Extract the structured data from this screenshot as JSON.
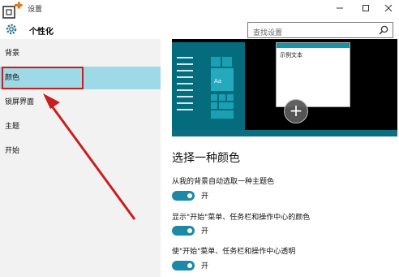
{
  "window": {
    "title": "设置"
  },
  "header": {
    "page_title": "个性化",
    "search_placeholder": "查找设置"
  },
  "sidebar": {
    "items": [
      {
        "label": "背景",
        "active": false
      },
      {
        "label": "颜色",
        "active": true
      },
      {
        "label": "锁屏界面",
        "active": false
      },
      {
        "label": "主题",
        "active": false
      },
      {
        "label": "开始",
        "active": false
      }
    ]
  },
  "preview": {
    "window_text": "示例文本",
    "tile_text": "Aa",
    "add_symbol": "+"
  },
  "main": {
    "section_title": "选择一种颜色",
    "settings": [
      {
        "label": "从我的背景自动选取一种主题色",
        "state": "开",
        "on": true
      },
      {
        "label": "显示\"开始\"菜单、任务栏和操作中心的颜色",
        "state": "开",
        "on": true
      },
      {
        "label": "使\"开始\"菜单、任务栏和操作中心透明",
        "state": "开",
        "on": true
      }
    ]
  },
  "colors": {
    "accent": "#1c8aa6",
    "selected_nav": "#9ed9e8",
    "annotation": "#c81e1e"
  }
}
